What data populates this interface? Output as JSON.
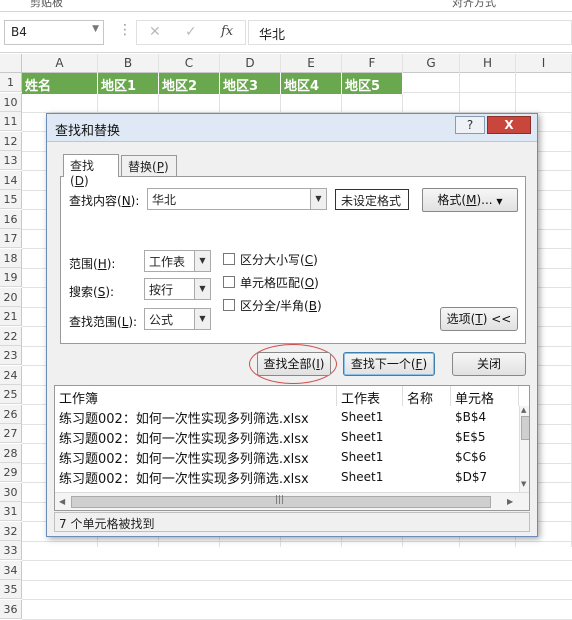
{
  "ribbon_remnant": {
    "group1": "剪贴板",
    "group2": "对齐方式"
  },
  "formula_bar": {
    "name_box": "B4",
    "content": "华北"
  },
  "columns": [
    "A",
    "B",
    "C",
    "D",
    "E",
    "F",
    "G",
    "H",
    "I"
  ],
  "rows": [
    "1",
    "10",
    "11",
    "12",
    "13",
    "14",
    "15",
    "16",
    "17",
    "18",
    "19",
    "20",
    "21",
    "22",
    "23",
    "24",
    "25",
    "26",
    "27",
    "28",
    "29",
    "30",
    "31",
    "32",
    "33",
    "34",
    "35",
    "36"
  ],
  "row1_cells": [
    "姓名",
    "地区1",
    "地区2",
    "地区3",
    "地区4",
    "地区5"
  ],
  "dialog": {
    "title": "查找和替换",
    "help_btn": "?",
    "close_btn": "X",
    "tabs": [
      {
        "label": "查找(",
        "key": "D",
        "tail": ")"
      },
      {
        "label": "替换(",
        "key": "P",
        "tail": ")"
      }
    ],
    "find_label": "查找内容(",
    "find_key": "N",
    "find_tail": "):",
    "find_value": "华北",
    "no_format": "未设定格式",
    "format_btn": "格式(",
    "format_key": "M",
    "format_tail": ")...",
    "within_label": "范围(",
    "within_key": "H",
    "within_tail": "):",
    "within_value": "工作表",
    "search_label": "搜索(",
    "search_key": "S",
    "search_tail": "):",
    "search_value": "按行",
    "lookin_label": "查找范围(",
    "lookin_key": "L",
    "lookin_tail": "):",
    "lookin_value": "公式",
    "chk_case": "区分大小写(",
    "chk_case_key": "C",
    "chk_case_tail": ")",
    "chk_cell": "单元格匹配(",
    "chk_cell_key": "O",
    "chk_cell_tail": ")",
    "chk_width": "区分全/半角(",
    "chk_width_key": "B",
    "chk_width_tail": ")",
    "options_btn": "选项(",
    "options_key": "T",
    "options_tail": ") <<",
    "find_all_btn": "查找全部(",
    "find_all_key": "I",
    "find_all_tail": ")",
    "find_next_btn": "查找下一个(",
    "find_next_key": "F",
    "find_next_tail": ")",
    "close_button": "关闭",
    "results_headers": [
      "工作簿",
      "工作表",
      "名称",
      "单元格"
    ],
    "results": [
      {
        "book": "练习题002：如何一次性实现多列筛选.xlsx",
        "sheet": "Sheet1",
        "name": "",
        "cell": "$B$4"
      },
      {
        "book": "练习题002：如何一次性实现多列筛选.xlsx",
        "sheet": "Sheet1",
        "name": "",
        "cell": "$E$5"
      },
      {
        "book": "练习题002：如何一次性实现多列筛选.xlsx",
        "sheet": "Sheet1",
        "name": "",
        "cell": "$C$6"
      },
      {
        "book": "练习题002：如何一次性实现多列筛选.xlsx",
        "sheet": "Sheet1",
        "name": "",
        "cell": "$D$7"
      }
    ],
    "status": "7 个单元格被找到"
  }
}
